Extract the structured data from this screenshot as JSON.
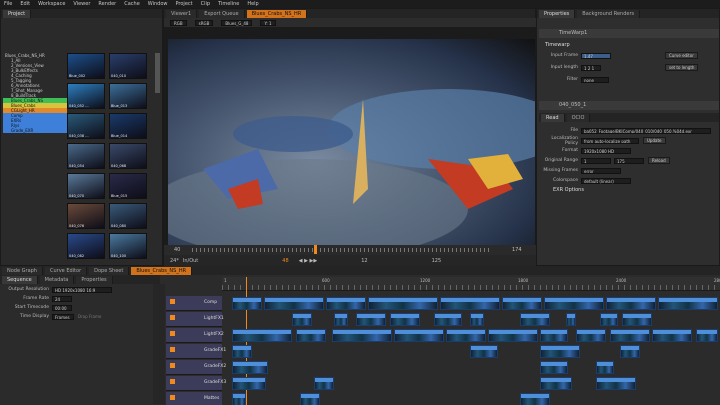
{
  "menu": [
    "File",
    "Edit",
    "Workspace",
    "Viewer",
    "Render",
    "Cache",
    "Window",
    "Project",
    "Clip",
    "Timeline",
    "Help"
  ],
  "project_panel": {
    "tab": "Project",
    "tree": [
      "Blues_Crabs_NS_HR",
      "1_All",
      "2_Versions_View",
      "3_BulkEffects",
      "4_Caching",
      "5_Tagging",
      "6_Annotations",
      "7_Shot_Manage",
      "8_BuildTrack",
      "Blues_Crabs_NS",
      "Blues_Crabs",
      "CGLight_HR",
      "Comp",
      "EXRs",
      "Rlys",
      "Grade_EXR"
    ],
    "thumbs": [
      "Blue_002",
      "040_010",
      "040_052 ...",
      "Blue_013",
      "040_038 ...",
      "Blue_014",
      "040_054",
      "040_068",
      "040_070",
      "Blue_015",
      "040_076",
      "040_080",
      "040_082",
      "040_100"
    ]
  },
  "viewer": {
    "tabs": [
      "Viewer1",
      "Export Queue",
      "Blues_Crabs_NS_HR"
    ],
    "toolbar": [
      "RGB",
      "sRGB",
      "Blues_G_48",
      "Y: 1"
    ],
    "frame_start": "40",
    "frame_end": "174",
    "current_frame": "48",
    "in_out": "In/Out",
    "fps": "24*",
    "frame_count": "12",
    "end_count": "125"
  },
  "properties": {
    "tabs": [
      "Properties",
      "Background Renders"
    ],
    "timewarp": {
      "title": "TimeWarp1",
      "section": "Timewarp",
      "input_frame_label": "Input Frame",
      "input_frame_value": "1.47",
      "curve_editor": "Curve editor",
      "input_length_label": "Input length",
      "input_length_value": "1 2 1",
      "set_to_length": "set to length",
      "filter_label": "Filter",
      "filter_value": "none"
    },
    "read": {
      "title": "040_050_1",
      "tabs": [
        "Read",
        "OCIO"
      ],
      "file_label": "File",
      "file_value": "ba052_Footage/BKIComp/040_010/040_050.%04d.exr",
      "localization_label": "Localization Policy",
      "localization_value": "from auto-localize path",
      "update": "Update",
      "format_label": "Format",
      "format_value": "1920x1080 HD",
      "original_range_label": "Original Range",
      "range_start": "1",
      "range_end": "175",
      "reload": "Reload",
      "missing_frames_label": "Missing Frames",
      "missing_frames_value": "error",
      "colorspace_label": "Colorspace",
      "colorspace_value": "default (linear)",
      "exr_options": "EXR Options"
    }
  },
  "bottom": {
    "tabs": [
      "Node Graph",
      "Curve Editor",
      "Dope Sheet",
      "Blues_Crabs_NS_HR"
    ],
    "seq_tabs": [
      "Sequence",
      "Metadata",
      "Properties"
    ],
    "output_resolution_label": "Output Resolution",
    "output_resolution_value": "HD 1920x1080 16:9",
    "frame_rate_label": "Frame Rate",
    "frame_rate_value": "24",
    "start_timecode_label": "Start Timecode",
    "start_timecode_value": "00:00",
    "time_display_label": "Time Display",
    "time_display_value": "Frames",
    "drop_frame": "Drop Frame",
    "ruler": [
      "1",
      "600",
      "1200",
      "1800",
      "2400",
      "2800"
    ],
    "tracks": [
      "Comp",
      "LightFX1",
      "LightFX2",
      "GradeFX1",
      "GradeFX2",
      "GradeFX3",
      "Mattes"
    ]
  },
  "colors": {
    "accent": "#f08a1c",
    "clip": "#4f8fd9",
    "track_head": "#3c3c5a"
  }
}
